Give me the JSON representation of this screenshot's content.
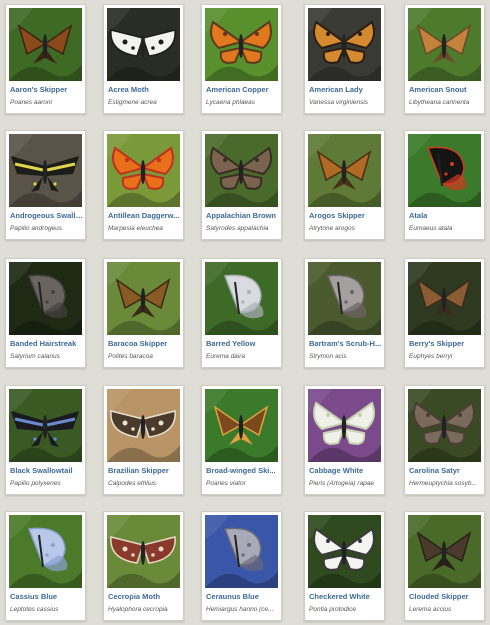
{
  "butterflies": [
    {
      "common": "Aaron's Skipper",
      "scientific": "Poanes aaroni",
      "icon": "skipper-butterfly-icon",
      "bg": "#3f6a25",
      "wing": "#8a4a1c",
      "accent": "#3a2410",
      "shape": "skipper"
    },
    {
      "common": "Acrea Moth",
      "scientific": "Estigmene acrea",
      "icon": "moth-icon",
      "bg": "#2a2d24",
      "wing": "#f2f2ee",
      "accent": "#1c1c1c",
      "shape": "moth"
    },
    {
      "common": "American Copper",
      "scientific": "Lycaena phlaeas",
      "icon": "copper-butterfly-icon",
      "bg": "#58902e",
      "wing": "#e2781e",
      "accent": "#5b3a1e",
      "shape": "open"
    },
    {
      "common": "American Lady",
      "scientific": "Vanessa virginiensis",
      "icon": "lady-butterfly-icon",
      "bg": "#3a3a34",
      "wing": "#d68a30",
      "accent": "#2a1e16",
      "shape": "open"
    },
    {
      "common": "American Snout",
      "scientific": "Libytheana carinenta",
      "icon": "snout-butterfly-icon",
      "bg": "#4e7a2c",
      "wing": "#c4823a",
      "accent": "#6b4a2a",
      "shape": "skipper"
    },
    {
      "common": "Androgeous Swallo...",
      "scientific": "Papilio androgeus",
      "icon": "swallowtail-butterfly-icon",
      "bg": "#5a5448",
      "wing": "#1c1c18",
      "accent": "#e0d44a",
      "shape": "swallow"
    },
    {
      "common": "Antillean Daggerw...",
      "scientific": "Marpesia eleuchea",
      "icon": "daggerwing-butterfly-icon",
      "bg": "#7a9a3a",
      "wing": "#e8701a",
      "accent": "#c03020",
      "shape": "open"
    },
    {
      "common": "Appalachian Brown",
      "scientific": "Satyrodes appalachia",
      "icon": "brown-butterfly-icon",
      "bg": "#4a6a2c",
      "wing": "#7a6450",
      "accent": "#3a2e24",
      "shape": "open"
    },
    {
      "common": "Arogos Skipper",
      "scientific": "Atrytone arogos",
      "icon": "skipper-butterfly-icon",
      "bg": "#5e7a36",
      "wing": "#b06a24",
      "accent": "#4a2e14",
      "shape": "skipper"
    },
    {
      "common": "Atala",
      "scientific": "Eumaeus atala",
      "icon": "atala-butterfly-icon",
      "bg": "#3a7a2a",
      "wing": "#141414",
      "accent": "#d03a20",
      "shape": "closed"
    },
    {
      "common": "Banded Hairstreak",
      "scientific": "Satyrium calanus",
      "icon": "hairstreak-butterfly-icon",
      "bg": "#1e2a14",
      "wing": "#6a6460",
      "accent": "#444040",
      "shape": "closed"
    },
    {
      "common": "Baracoa Skipper",
      "scientific": "Polites baracoa",
      "icon": "skipper-butterfly-icon",
      "bg": "#6a8a3a",
      "wing": "#8a5a24",
      "accent": "#3a2a14",
      "shape": "skipper"
    },
    {
      "common": "Barred Yellow",
      "scientific": "Eurema daira",
      "icon": "yellow-butterfly-icon",
      "bg": "#3e6a28",
      "wing": "#d8dce0",
      "accent": "#a8b0b8",
      "shape": "closed"
    },
    {
      "common": "Bartram's Scrub-H...",
      "scientific": "Strymon acis",
      "icon": "hairstreak-butterfly-icon",
      "bg": "#4a5a2e",
      "wing": "#a4a0a0",
      "accent": "#6a6464",
      "shape": "closed"
    },
    {
      "common": "Berry's Skipper",
      "scientific": "Euphyes berryi",
      "icon": "skipper-butterfly-icon",
      "bg": "#2e3a20",
      "wing": "#8a5c34",
      "accent": "#3a2a1a",
      "shape": "skipper"
    },
    {
      "common": "Black Swallowtail",
      "scientific": "Papilio polyxenes",
      "icon": "swallowtail-butterfly-icon",
      "bg": "#3a5a24",
      "wing": "#1a1a1e",
      "accent": "#6a8ad0",
      "shape": "swallow"
    },
    {
      "common": "Brazilian Skipper",
      "scientific": "Calpodes ethlius",
      "icon": "skipper-butterfly-icon",
      "bg": "#b89466",
      "wing": "#4a3a2c",
      "accent": "#e8e0d0",
      "shape": "moth"
    },
    {
      "common": "Broad-winged Ski...",
      "scientific": "Poanes viator",
      "icon": "skipper-butterfly-icon",
      "bg": "#3a7a2a",
      "wing": "#7a4a1e",
      "accent": "#e0a040",
      "shape": "skipper"
    },
    {
      "common": "Cabbage White",
      "scientific": "Pieris (Artogeia) rapae",
      "icon": "white-butterfly-icon",
      "bg": "#7a4a8a",
      "wing": "#f0f2ea",
      "accent": "#c8d4b0",
      "shape": "open"
    },
    {
      "common": "Carolina Satyr",
      "scientific": "Hermeuptychia sosyb...",
      "icon": "satyr-butterfly-icon",
      "bg": "#3a4a24",
      "wing": "#7a6a5c",
      "accent": "#4a3e34",
      "shape": "open"
    },
    {
      "common": "Cassius Blue",
      "scientific": "Leptotes cassius",
      "icon": "blue-butterfly-icon",
      "bg": "#4a7a2a",
      "wing": "#b8c8e8",
      "accent": "#8aa0d0",
      "shape": "closed"
    },
    {
      "common": "Cecropia Moth",
      "scientific": "Hyalophora cecropia",
      "icon": "moth-icon",
      "bg": "#6a8a3a",
      "wing": "#8a3a2a",
      "accent": "#e8d8c8",
      "shape": "moth"
    },
    {
      "common": "Ceraunus Blue",
      "scientific": "Hemiargus hanno (ce...",
      "icon": "blue-butterfly-icon",
      "bg": "#3a56a8",
      "wing": "#a8aab8",
      "accent": "#6a6a7a",
      "shape": "closed"
    },
    {
      "common": "Checkered White",
      "scientific": "Pontia protodice",
      "icon": "white-butterfly-icon",
      "bg": "#2e4a1e",
      "wing": "#f4f4f2",
      "accent": "#3a3a3a",
      "shape": "open"
    },
    {
      "common": "Clouded Skipper",
      "scientific": "Lerema accius",
      "icon": "skipper-butterfly-icon",
      "bg": "#4a6a2a",
      "wing": "#4a3a2c",
      "accent": "#2a2018",
      "shape": "skipper"
    }
  ]
}
